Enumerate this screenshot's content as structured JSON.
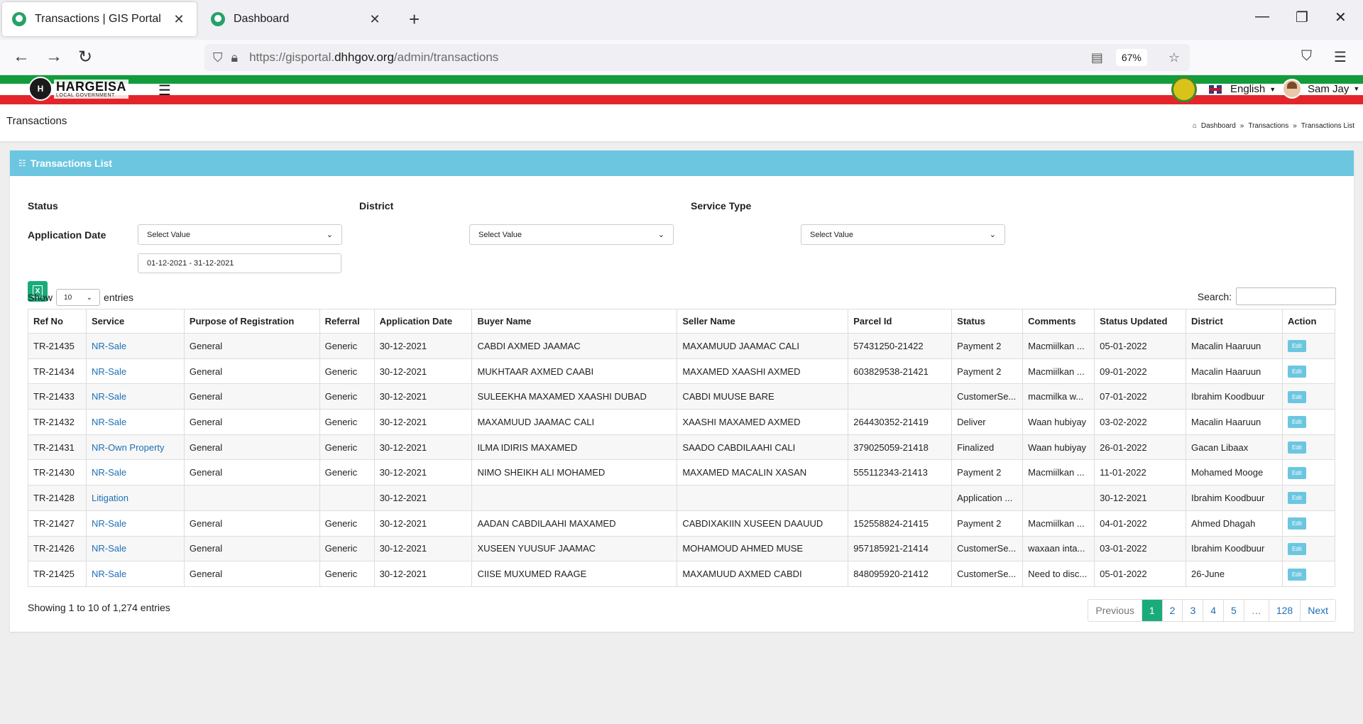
{
  "browser": {
    "tabs": [
      {
        "title": "Transactions | GIS Portal",
        "active": true
      },
      {
        "title": "Dashboard",
        "active": false
      }
    ],
    "url_prefix": "https://gisportal.",
    "url_domain": "dhhgov.org",
    "url_path": "/admin/transactions",
    "zoom": "67%"
  },
  "header": {
    "logo_title": "HARGEISA",
    "logo_subtitle": "LOCAL GOVERNMENT",
    "logo_mark": "H",
    "language": "English",
    "user_name": "Sam Jay"
  },
  "page": {
    "title": "Transactions",
    "breadcrumb": [
      "Dashboard",
      "Transactions",
      "Transactions List"
    ]
  },
  "card": {
    "title": "Transactions List"
  },
  "filters": {
    "status_label": "Status",
    "status_value": "Select Value",
    "district_label": "District",
    "district_value": "Select Value",
    "service_type_label": "Service Type",
    "service_type_value": "Select Value",
    "application_date_label": "Application Date",
    "application_date_value": "01-12-2021 - 31-12-2021"
  },
  "table_controls": {
    "show_label": "Show",
    "entries_label": "entries",
    "page_length": "10",
    "search_label": "Search:"
  },
  "table": {
    "columns": [
      "Ref No",
      "Service",
      "Purpose of Registration",
      "Referral",
      "Application Date",
      "Buyer Name",
      "Seller Name",
      "Parcel Id",
      "Status",
      "Comments",
      "Status Updated",
      "District",
      "Action"
    ],
    "rows": [
      [
        "TR-21435",
        "NR-Sale",
        "General",
        "Generic",
        "30-12-2021",
        "CABDI AXMED JAAMAC",
        "MAXAMUUD JAAMAC CALI",
        "57431250-21422",
        "Payment 2",
        "Macmiilkan ...",
        "05-01-2022",
        "Macalin Haaruun",
        "Edit"
      ],
      [
        "TR-21434",
        "NR-Sale",
        "General",
        "Generic",
        "30-12-2021",
        "MUKHTAAR AXMED CAABI",
        "MAXAMED XAASHI AXMED",
        "603829538-21421",
        "Payment 2",
        "Macmiilkan ...",
        "09-01-2022",
        "Macalin Haaruun",
        "Edit"
      ],
      [
        "TR-21433",
        "NR-Sale",
        "General",
        "Generic",
        "30-12-2021",
        "SULEEKHA MAXAMED XAASHI DUBAD",
        "CABDI MUUSE BARE",
        "",
        "CustomerSe...",
        "macmilka w...",
        "07-01-2022",
        "Ibrahim Koodbuur",
        "Edit"
      ],
      [
        "TR-21432",
        "NR-Sale",
        "General",
        "Generic",
        "30-12-2021",
        "MAXAMUUD JAAMAC CALI",
        "XAASHI MAXAMED AXMED",
        "264430352-21419",
        "Deliver",
        "Waan hubiyay",
        "03-02-2022",
        "Macalin Haaruun",
        "Edit"
      ],
      [
        "TR-21431",
        "NR-Own Property",
        "General",
        "Generic",
        "30-12-2021",
        "ILMA IDIRIS MAXAMED",
        "SAADO CABDILAAHI CALI",
        "379025059-21418",
        "Finalized",
        "Waan hubiyay",
        "26-01-2022",
        "Gacan Libaax",
        "Edit"
      ],
      [
        "TR-21430",
        "NR-Sale",
        "General",
        "Generic",
        "30-12-2021",
        "NIMO SHEIKH ALI MOHAMED",
        "MAXAMED MACALIN XASAN",
        "555112343-21413",
        "Payment 2",
        "Macmiilkan ...",
        "11-01-2022",
        "Mohamed Mooge",
        "Edit"
      ],
      [
        "TR-21428",
        "Litigation",
        "",
        "",
        "30-12-2021",
        "",
        "",
        "",
        "Application ...",
        "",
        "30-12-2021",
        "Ibrahim Koodbuur",
        "Edit"
      ],
      [
        "TR-21427",
        "NR-Sale",
        "General",
        "Generic",
        "30-12-2021",
        "AADAN CABDILAAHI MAXAMED",
        "CABDIXAKIIN XUSEEN DAAUUD",
        "152558824-21415",
        "Payment 2",
        "Macmiilkan ...",
        "04-01-2022",
        "Ahmed Dhagah",
        "Edit"
      ],
      [
        "TR-21426",
        "NR-Sale",
        "General",
        "Generic",
        "30-12-2021",
        "XUSEEN YUUSUF JAAMAC",
        "MOHAMOUD AHMED MUSE",
        "957185921-21414",
        "CustomerSe...",
        "waxaan inta...",
        "03-01-2022",
        "Ibrahim Koodbuur",
        "Edit"
      ],
      [
        "TR-21425",
        "NR-Sale",
        "General",
        "Generic",
        "30-12-2021",
        "CIISE MUXUMED RAAGE",
        "MAXAMUUD AXMED CABDI",
        "848095920-21412",
        "CustomerSe...",
        "Need to disc...",
        "05-01-2022",
        "26-June",
        "Edit"
      ]
    ]
  },
  "footer": {
    "info": "Showing 1 to 10 of 1,274 entries",
    "pagination": [
      "Previous",
      "1",
      "2",
      "3",
      "4",
      "5",
      "…",
      "128",
      "Next"
    ],
    "active_page": "1"
  },
  "colors": {
    "green_stripe": "#139b3c",
    "red_stripe": "#e3252b",
    "card_header": "#6cc6e0",
    "accent": "#1aab7a",
    "link": "#1f6fb5"
  }
}
